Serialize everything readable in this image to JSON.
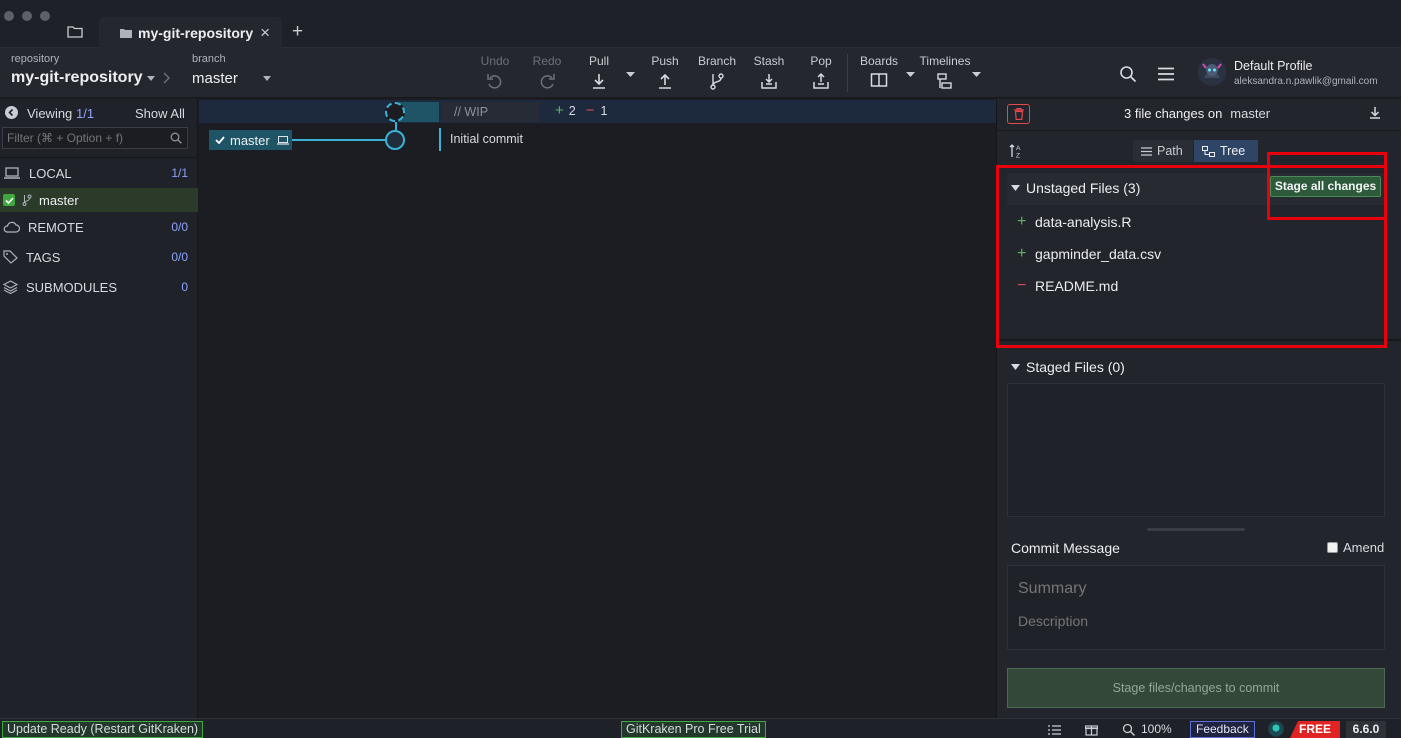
{
  "titlebar": {
    "tab_title": "my-git-repository",
    "close_glyph": "×",
    "add_glyph": "+"
  },
  "toolbar": {
    "repo_label": "repository",
    "repo_name": "my-git-repository",
    "branch_label": "branch",
    "branch_name": "master",
    "undo": "Undo",
    "redo": "Redo",
    "pull": "Pull",
    "push": "Push",
    "branch": "Branch",
    "stash": "Stash",
    "pop": "Pop",
    "boards": "Boards",
    "timelines": "Timelines",
    "profile_name": "Default Profile",
    "profile_email": "aleksandra.n.pawlik@gmail.com"
  },
  "sidebar": {
    "viewing_label": "Viewing",
    "viewing_count": "1/1",
    "show_all": "Show All",
    "filter_placeholder": "Filter (⌘ + Option + f)",
    "sections": [
      {
        "label": "LOCAL",
        "count": "1/1"
      },
      {
        "label": "REMOTE",
        "count": "0/0"
      },
      {
        "label": "TAGS",
        "count": "0/0"
      },
      {
        "label": "SUBMODULES",
        "count": "0"
      }
    ],
    "local_branch": "master"
  },
  "graph": {
    "wip_label": "// WIP",
    "wip_added": "2",
    "wip_removed": "1",
    "branch_tag": "master",
    "commit_message": "Initial commit"
  },
  "right_panel": {
    "file_changes_text": "3 file changes on",
    "file_changes_branch": "master",
    "view_path": "Path",
    "view_tree": "Tree",
    "unstaged_title": "Unstaged Files (3)",
    "stage_all_button": "Stage all changes",
    "unstaged_files": [
      {
        "name": "data-analysis.R",
        "status": "+"
      },
      {
        "name": "gapminder_data.csv",
        "status": "+"
      },
      {
        "name": "README.md",
        "status": "−"
      }
    ],
    "staged_title": "Staged Files (0)",
    "commit_message_label": "Commit Message",
    "amend_label": "Amend",
    "summary_placeholder": "Summary",
    "description_placeholder": "Description",
    "commit_button": "Stage files/changes to commit"
  },
  "statusbar": {
    "update_ready": "Update Ready (Restart GitKraken)",
    "pro_trial": "GitKraken Pro Free Trial",
    "zoom": "100%",
    "feedback": "Feedback",
    "plan": "FREE",
    "version": "6.6.0"
  },
  "colors": {
    "accent_green": "#5cb85c",
    "accent_red": "#e5484d",
    "highlight_red": "#e8000d",
    "graph_teal": "#3ab3d6"
  }
}
